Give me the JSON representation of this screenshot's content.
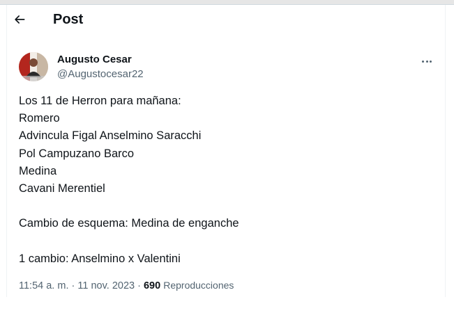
{
  "header": {
    "title": "Post",
    "back_icon": "arrow-left-icon"
  },
  "author": {
    "name": "Augusto Cesar",
    "handle": "@Augustocesar22",
    "avatar_icon": "user-avatar-photo",
    "more_icon": "ellipsis-icon"
  },
  "tweet": {
    "lines": [
      "Los 11 de Herron para mañana:",
      "Romero",
      "Advincula Figal Anselmino Saracchi",
      "Pol Campuzano Barco",
      "Medina",
      "Cavani Merentiel",
      "",
      "Cambio de esquema: Medina de enganche",
      "",
      "1 cambio: Anselmino x Valentini"
    ]
  },
  "meta": {
    "time": "11:54 a. m.",
    "separator": "·",
    "date": "11 nov. 2023",
    "views_count": "690",
    "views_label": "Reproducciones"
  },
  "colors": {
    "text_primary": "#0f1419",
    "text_secondary": "#536471",
    "border": "#eff3f4"
  }
}
